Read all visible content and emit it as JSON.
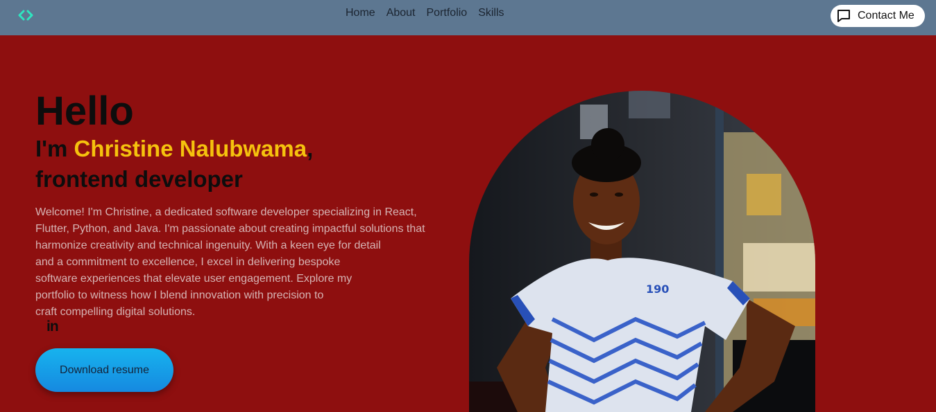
{
  "nav": {
    "links": [
      "Home",
      "About",
      "Portfolio",
      "Skills"
    ],
    "contact_label": "Contact Me",
    "logo_icon": "code-brackets-icon",
    "logo_color": "#2ee6c0"
  },
  "hero": {
    "greeting": "Hello",
    "intro_prefix": "I'm ",
    "name": "Christine Nalubwama",
    "intro_suffix": ",",
    "role": "frontend developer",
    "bio_lines": [
      "Welcome! I'm Christine, a dedicated software developer specializing in React,",
      "Flutter, Python, and Java. I'm passionate about creating impactful solutions that",
      "harmonize creativity and technical ingenuity. With a keen eye for detail",
      "and a commitment to excellence, I excel in delivering bespoke",
      "software experiences that elevate user engagement. Explore my",
      "portfolio to witness how I blend innovation with precision to",
      "craft compelling digital solutions."
    ],
    "social_icon": "linkedin-icon",
    "social_text": "in",
    "download_label": "Download resume"
  },
  "colors": {
    "background": "#8e0f0f",
    "navbar": "#5d7791",
    "name_accent": "#f5c20e",
    "button": "#1ca0e8"
  }
}
